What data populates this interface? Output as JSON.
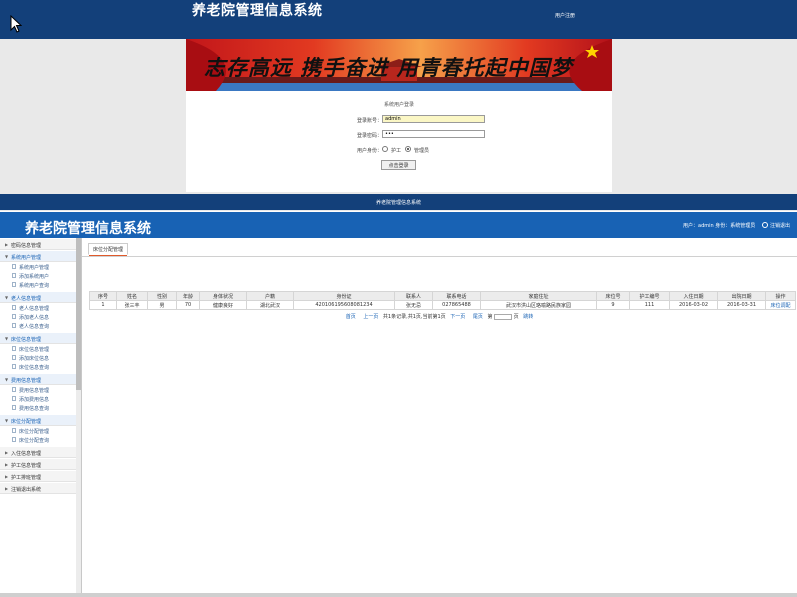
{
  "login_page": {
    "title": "养老院管理信息系统",
    "register_link": "用户注册",
    "slogan": "志存高远 携手奋进 用青春托起中国梦",
    "form_title": "系统用户登录",
    "username_label": "登录账号：",
    "username_value": "admin",
    "password_label": "登录密码：",
    "password_value": "•••",
    "role_label": "用户身份：",
    "role_options": [
      "护工",
      "管理员"
    ],
    "role_selected": "管理员",
    "login_button": "点击登录",
    "footer": "养老院管理信息系统"
  },
  "admin": {
    "title": "养老院管理信息系统",
    "user_info": "用户：admin 身份：系统管理员",
    "logout": "注销退出",
    "sidebar": [
      {
        "label": "密码信息管理",
        "open": false,
        "items": []
      },
      {
        "label": "系统用户管理",
        "open": true,
        "items": [
          "系统用户管理",
          "添加系统用户",
          "系统用户查询"
        ]
      },
      {
        "label": "老人信息管理",
        "open": true,
        "items": [
          "老人信息管理",
          "添加老人信息",
          "老人信息查询"
        ]
      },
      {
        "label": "床位信息管理",
        "open": true,
        "items": [
          "床位信息管理",
          "添加床位信息",
          "床位信息查询"
        ]
      },
      {
        "label": "费用信息管理",
        "open": true,
        "items": [
          "费用信息管理",
          "添加费用信息",
          "费用信息查询"
        ]
      },
      {
        "label": "床位分配管理",
        "open": true,
        "items": [
          "床位分配管理",
          "床位分配查询"
        ]
      },
      {
        "label": "入住信息管理",
        "open": false,
        "items": []
      },
      {
        "label": "护工信息管理",
        "open": false,
        "items": []
      },
      {
        "label": "护工排班管理",
        "open": false,
        "items": []
      },
      {
        "label": "注销退出系统",
        "open": false,
        "items": []
      }
    ],
    "tab": "床位分配管理",
    "table": {
      "headers": [
        "序号",
        "姓名",
        "性别",
        "年龄",
        "身体状况",
        "户籍",
        "身份证",
        "联系人",
        "联系电话",
        "家庭住址",
        "床位号",
        "护工编号",
        "入住日期",
        "出院日期",
        "操作"
      ],
      "rows": [
        [
          "1",
          "张三丰",
          "男",
          "70",
          "健康良好",
          "湖北武汉",
          "420106195608081234",
          "张无忌",
          "027865488",
          "武汉市洪山区珞喻路民族家园",
          "9",
          "111",
          "2016-03-02",
          "2016-03-31",
          "床位调配"
        ]
      ]
    },
    "pager": {
      "first": "首页",
      "prev": "上一页",
      "summary": "共1条记录,共1页,当前第1页",
      "next": "下一页",
      "last": "尾页",
      "goto": "第",
      "page_suffix": "页",
      "go": "跳转"
    }
  }
}
